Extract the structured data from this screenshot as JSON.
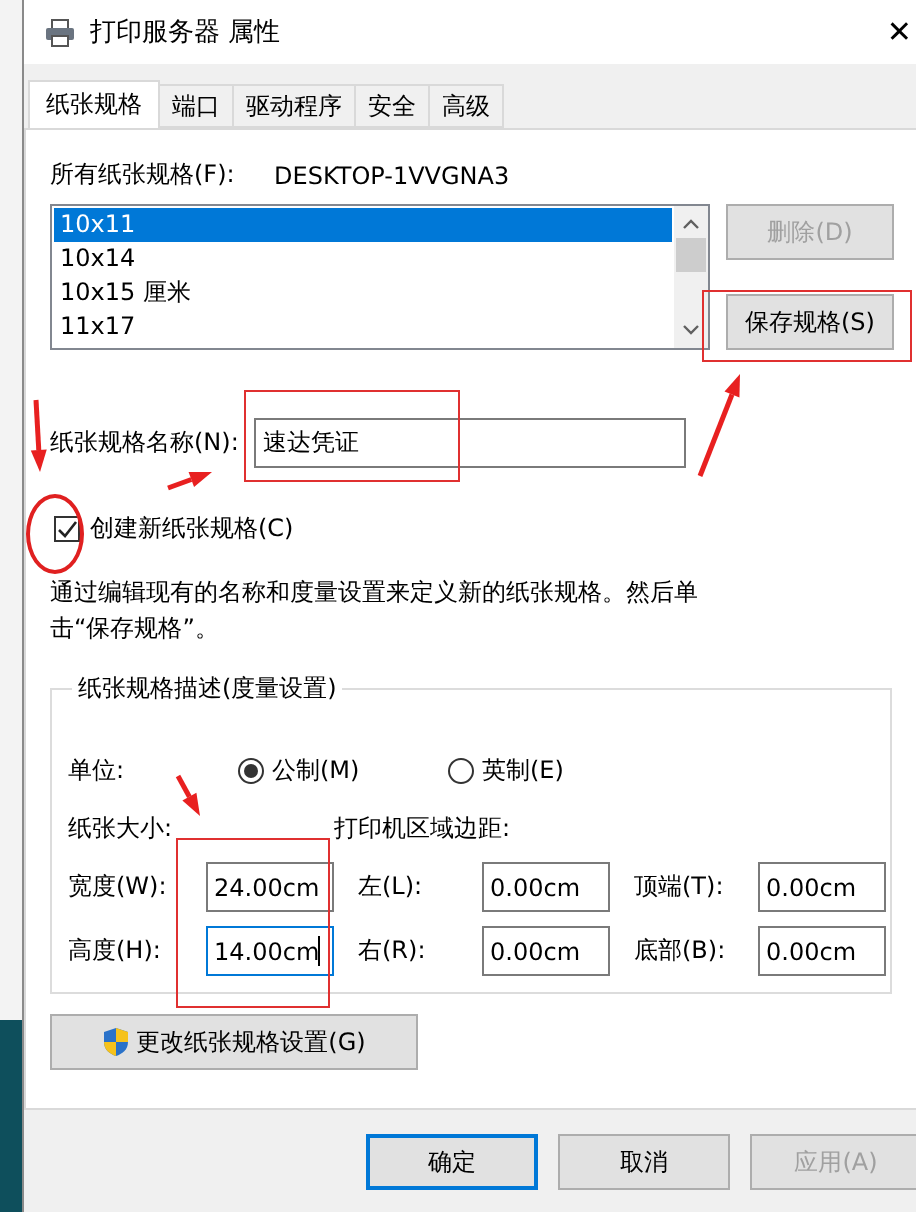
{
  "window": {
    "title": "打印服务器 属性",
    "close": "✕"
  },
  "tabs": [
    {
      "label": "纸张规格",
      "selected": true
    },
    {
      "label": "端口",
      "selected": false
    },
    {
      "label": "驱动程序",
      "selected": false
    },
    {
      "label": "安全",
      "selected": false
    },
    {
      "label": "高级",
      "selected": false
    }
  ],
  "forms_label": "所有纸张规格(F):",
  "server_name": "DESKTOP-1VVGNA3",
  "forms": [
    {
      "label": "10x11",
      "selected": true
    },
    {
      "label": "10x14",
      "selected": false
    },
    {
      "label": "10x15 厘米",
      "selected": false
    },
    {
      "label": "11x17",
      "selected": false
    }
  ],
  "side_buttons": [
    {
      "label": "删除(D)",
      "disabled": true
    },
    {
      "label": "保存规格(S)",
      "disabled": false
    }
  ],
  "form_name": {
    "label": "纸张规格名称(N):",
    "value": "速达凭证"
  },
  "create_new": {
    "label": "创建新纸张规格(C)",
    "checked": true
  },
  "description": "通过编辑现有的名称和度量设置来定义新的纸张规格。然后单击“保存规格”。",
  "measurements": {
    "title": "纸张规格描述(度量设置)",
    "units_label": "单位:",
    "units": [
      {
        "label": "公制(M)",
        "selected": true
      },
      {
        "label": "英制(E)",
        "selected": false
      }
    ],
    "size_label": "纸张大小:",
    "margins_label": "打印机区域边距:",
    "rows": [
      [
        {
          "label": "宽度(W):",
          "value": "24.00cm",
          "focused": false
        },
        {
          "label": "左(L):",
          "value": "0.00cm",
          "focused": false
        },
        {
          "label": "顶端(T):",
          "value": "0.00cm",
          "focused": false
        }
      ],
      [
        {
          "label": "高度(H):",
          "value": "14.00cm",
          "focused": true
        },
        {
          "label": "右(R):",
          "value": "0.00cm",
          "focused": false
        },
        {
          "label": "底部(B):",
          "value": "0.00cm",
          "focused": false
        }
      ]
    ]
  },
  "change_button": "更改纸张规格设置(G)",
  "dialog_buttons": [
    {
      "label": "确定",
      "default": true,
      "disabled": false
    },
    {
      "label": "取消",
      "default": false,
      "disabled": false
    },
    {
      "label": "应用(A)",
      "default": false,
      "disabled": true
    }
  ]
}
